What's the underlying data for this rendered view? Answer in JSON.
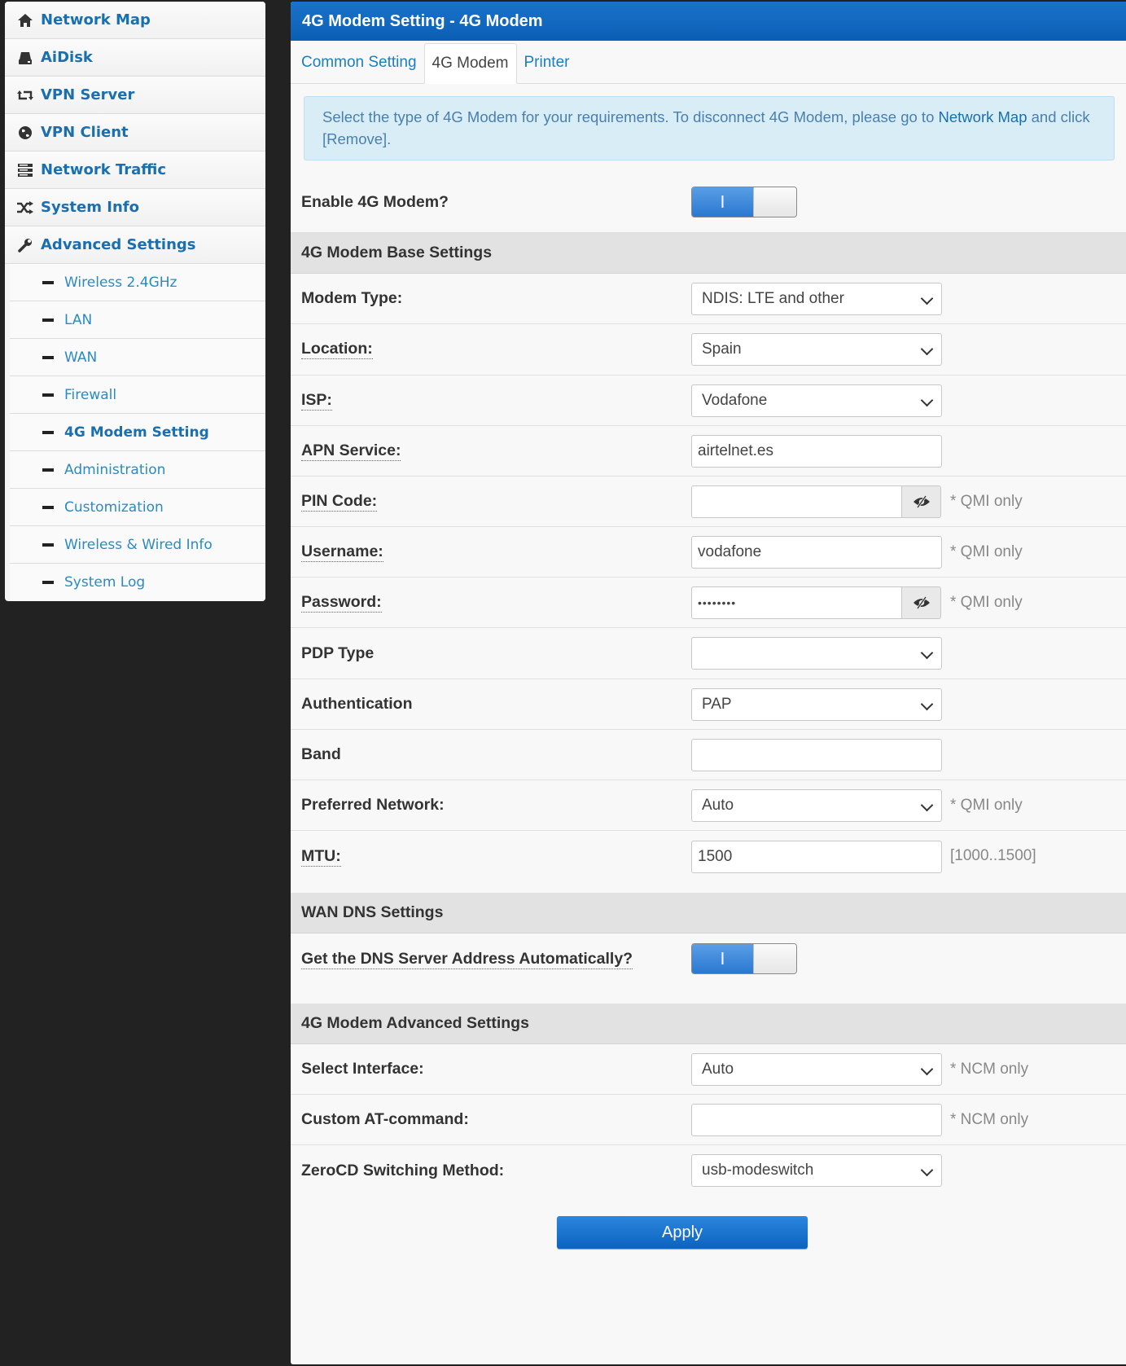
{
  "sidebar": {
    "items": [
      {
        "label": "Network Map",
        "icon": "home-icon"
      },
      {
        "label": "AiDisk",
        "icon": "drive-icon"
      },
      {
        "label": "VPN Server",
        "icon": "retweet-icon"
      },
      {
        "label": "VPN Client",
        "icon": "globe-icon"
      },
      {
        "label": "Network Traffic",
        "icon": "server-stack-icon"
      },
      {
        "label": "System Info",
        "icon": "shuffle-icon"
      },
      {
        "label": "Advanced Settings",
        "icon": "wrench-icon"
      }
    ],
    "subitems": [
      {
        "label": "Wireless 2.4GHz"
      },
      {
        "label": "LAN"
      },
      {
        "label": "WAN"
      },
      {
        "label": "Firewall"
      },
      {
        "label": "4G Modem Setting"
      },
      {
        "label": "Administration"
      },
      {
        "label": "Customization"
      },
      {
        "label": "Wireless & Wired Info"
      },
      {
        "label": "System Log"
      }
    ],
    "active_subitem": "4G Modem Setting"
  },
  "header": {
    "title": "4G Modem Setting - 4G Modem"
  },
  "tabs": [
    {
      "label": "Common Setting"
    },
    {
      "label": "4G Modem"
    },
    {
      "label": "Printer"
    }
  ],
  "active_tab": "4G Modem",
  "alert": {
    "text_before": "Select the type of 4G Modem for your requirements. To disconnect 4G Modem, please go to ",
    "link": "Network Map",
    "text_after": " and click [Remove]."
  },
  "enable": {
    "label": "Enable 4G Modem?",
    "toggle_glyph": "I",
    "value": "on"
  },
  "base_settings": {
    "title": "4G Modem Base Settings",
    "modem_type": {
      "label": "Modem Type:",
      "value": "NDIS: LTE and other"
    },
    "location": {
      "label": "Location:",
      "value": "Spain"
    },
    "isp": {
      "label": "ISP:",
      "value": "Vodafone"
    },
    "apn": {
      "label": "APN Service:",
      "value": "airtelnet.es"
    },
    "pin": {
      "label": "PIN Code:",
      "value": "",
      "hint": "* QMI only"
    },
    "username": {
      "label": "Username:",
      "value": "vodafone",
      "hint": "* QMI only"
    },
    "password": {
      "label": "Password:",
      "value": "••••••••",
      "hint": "* QMI only"
    },
    "pdp_type": {
      "label": "PDP Type",
      "value": ""
    },
    "authentication": {
      "label": "Authentication",
      "value": "PAP"
    },
    "band": {
      "label": "Band",
      "value": ""
    },
    "preferred_network": {
      "label": "Preferred Network:",
      "value": "Auto",
      "hint": "* QMI only"
    },
    "mtu": {
      "label": "MTU:",
      "value": "1500",
      "hint": "[1000..1500]"
    }
  },
  "dns_settings": {
    "title": "WAN DNS Settings",
    "auto_dns": {
      "label": "Get the DNS Server Address Automatically?",
      "toggle_glyph": "I",
      "value": "on"
    }
  },
  "advanced_settings": {
    "title": "4G Modem Advanced Settings",
    "interface": {
      "label": "Select Interface:",
      "value": "Auto",
      "hint": "* NCM only"
    },
    "at_command": {
      "label": "Custom AT-command:",
      "value": "",
      "hint": "* NCM only"
    },
    "zerocd": {
      "label": "ZeroCD Switching Method:",
      "value": "usb-modeswitch"
    }
  },
  "apply_label": "Apply"
}
